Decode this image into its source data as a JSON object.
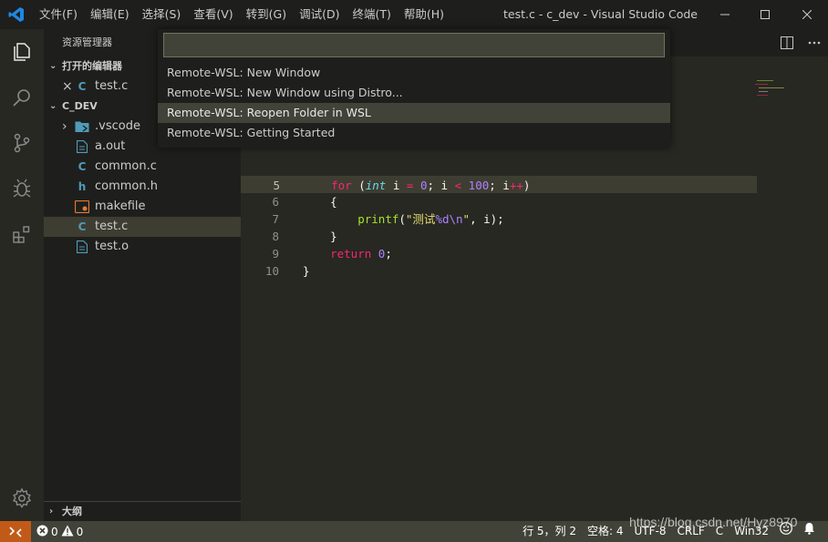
{
  "window": {
    "title": "test.c - c_dev - Visual Studio Code",
    "menu": [
      "文件(F)",
      "编辑(E)",
      "选择(S)",
      "查看(V)",
      "转到(G)",
      "调试(D)",
      "终端(T)",
      "帮助(H)"
    ]
  },
  "sidebar": {
    "header": "资源管理器",
    "open_editors": {
      "label": "打开的编辑器",
      "files": [
        {
          "close": "×",
          "icon": "C",
          "name": "test.c"
        }
      ]
    },
    "folder": {
      "label": "C_DEV",
      "items": [
        {
          "chevron": "›",
          "icon": "vscode-folder-icon",
          "name": ".vscode"
        },
        {
          "icon": "file-icon",
          "name": "a.out"
        },
        {
          "icon": "C",
          "name": "common.c"
        },
        {
          "icon": "h",
          "name": "common.h"
        },
        {
          "icon": "makefile-icon",
          "name": "makefile"
        },
        {
          "icon": "C",
          "name": "test.c"
        },
        {
          "icon": "file-icon",
          "name": "test.o"
        }
      ]
    },
    "outline": "大纲"
  },
  "editor": {
    "lines": [
      {
        "n": "5",
        "tokens": [
          [
            "kw",
            "for"
          ],
          [
            "p",
            " ("
          ],
          [
            "ty",
            "int"
          ],
          [
            "p",
            " i "
          ],
          [
            "kw",
            "="
          ],
          [
            "p",
            " "
          ],
          [
            "num",
            "0"
          ],
          [
            "p",
            "; i "
          ],
          [
            "kw",
            "<"
          ],
          [
            "p",
            " "
          ],
          [
            "num",
            "100"
          ],
          [
            "p",
            "; i"
          ],
          [
            "kw",
            "++"
          ],
          [
            "p",
            ")"
          ]
        ],
        "indent": "    "
      },
      {
        "n": "6",
        "tokens": [
          [
            "p",
            "{"
          ]
        ],
        "indent": "    "
      },
      {
        "n": "7",
        "tokens": [
          [
            "fn",
            "printf"
          ],
          [
            "p",
            "("
          ],
          [
            "str",
            "\"测试"
          ],
          [
            "esc",
            "%d\\n"
          ],
          [
            "str",
            "\""
          ],
          [
            "p",
            ", i);"
          ]
        ],
        "indent": "        "
      },
      {
        "n": "8",
        "tokens": [
          [
            "p",
            "}"
          ]
        ],
        "indent": "    "
      },
      {
        "n": "9",
        "tokens": [
          [
            "kw",
            "return"
          ],
          [
            "p",
            " "
          ],
          [
            "num",
            "0"
          ],
          [
            "p",
            ";"
          ]
        ],
        "indent": "    "
      },
      {
        "n": "10",
        "tokens": [
          [
            "p",
            "}"
          ]
        ],
        "indent": ""
      }
    ],
    "current_line": "5"
  },
  "quickpick": {
    "input_value": "",
    "items": [
      "Remote-WSL: New Window",
      "Remote-WSL: New Window using Distro...",
      "Remote-WSL: Reopen Folder in WSL",
      "Remote-WSL: Getting Started"
    ],
    "active_index": 2
  },
  "statusbar": {
    "errors": "0",
    "warnings": "0",
    "position": "行 5，列 2",
    "spaces": "空格: 4",
    "encoding": "UTF-8",
    "eol": "CRLF",
    "language": "C",
    "platform": "Win32"
  },
  "watermark": "https://blog.csdn.net/Hyz8970",
  "colors": {
    "remote_indicator": "#c15a18",
    "statusbar": "#414339",
    "c_icon": "#519aba",
    "makefile_icon": "#e37933"
  }
}
